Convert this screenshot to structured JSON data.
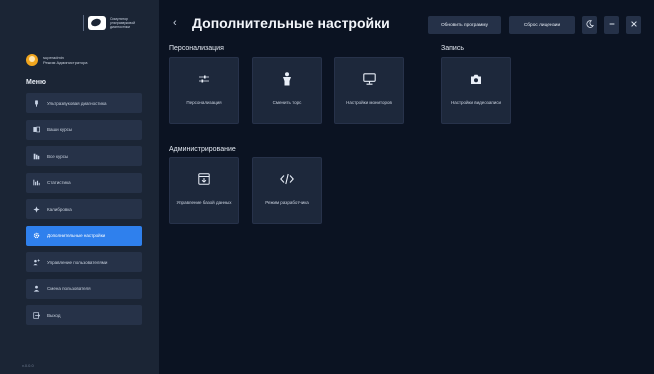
{
  "brand": {
    "logo_text": "Симулятор\nультразвуковой\nдиагностики"
  },
  "user": {
    "name": "superadmin",
    "role": "Режим Администратора"
  },
  "menu": {
    "title": "Меню",
    "items": [
      {
        "label": "Ультразвуковая диагностика",
        "icon": "ultrasound-icon",
        "active": false
      },
      {
        "label": "Ваши курсы",
        "icon": "book-icon",
        "active": false
      },
      {
        "label": "Все курсы",
        "icon": "library-icon",
        "active": false
      },
      {
        "label": "Статистика",
        "icon": "bar-chart-icon",
        "active": false
      },
      {
        "label": "Калибровка",
        "icon": "calibration-icon",
        "active": false
      },
      {
        "label": "Дополнительные настройки",
        "icon": "gear-icon",
        "active": true
      },
      {
        "label": "Управление пользователями",
        "icon": "users-icon",
        "active": false
      },
      {
        "label": "Смена пользователя",
        "icon": "user-icon",
        "active": false
      },
      {
        "label": "Выход",
        "icon": "logout-icon",
        "active": false
      }
    ]
  },
  "version": "v.0.0.0",
  "header": {
    "title": "Дополнительные настройки",
    "update_label": "Обновить программу",
    "license_label": "Сброс лицензии"
  },
  "sections": {
    "personalization": {
      "title": "Персонализация",
      "tiles": [
        {
          "label": "Персонализация",
          "icon": "sliders-icon"
        },
        {
          "label": "Сменить торс",
          "icon": "torso-icon"
        },
        {
          "label": "Настройки мониторов",
          "icon": "monitor-icon"
        }
      ]
    },
    "recording": {
      "title": "Запись",
      "tiles": [
        {
          "label": "Настройки видеозаписи",
          "icon": "camera-icon"
        }
      ]
    },
    "administration": {
      "title": "Администрирование",
      "tiles": [
        {
          "label": "Управление базой данных",
          "icon": "database-download-icon"
        },
        {
          "label": "Режим разработчика",
          "icon": "code-icon"
        }
      ]
    }
  },
  "colors": {
    "accent": "#2f80ed",
    "sidebar": "#1b2535",
    "background": "#0b1322",
    "tile": "#1d283b"
  }
}
